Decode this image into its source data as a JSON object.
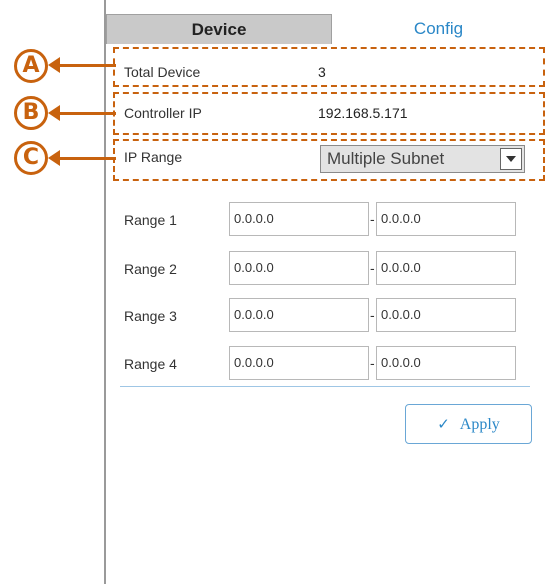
{
  "tabs": [
    {
      "label": "Device",
      "active": false
    },
    {
      "label": "Config",
      "active": true
    }
  ],
  "fields": {
    "total_device_label": "Total Device",
    "total_device_value": "3",
    "controller_ip_label": "Controller IP",
    "controller_ip_value": "192.168.5.171",
    "ip_range_label": "IP Range",
    "ip_range_value": "Multiple Subnet"
  },
  "callouts": [
    "A",
    "B",
    "C"
  ],
  "ranges": [
    {
      "label": "Range 1",
      "start": "0.0.0.0",
      "end": "0.0.0.0"
    },
    {
      "label": "Range 2",
      "start": "0.0.0.0",
      "end": "0.0.0.0"
    },
    {
      "label": "Range 3",
      "start": "0.0.0.0",
      "end": "0.0.0.0"
    },
    {
      "label": "Range 4",
      "start": "0.0.0.0",
      "end": "0.0.0.0"
    }
  ],
  "range_separator": "-",
  "apply_label": "Apply",
  "colors": {
    "accent": "#2a87c7",
    "callout": "#c8620e",
    "tab_inactive": "#c9c9c9"
  }
}
